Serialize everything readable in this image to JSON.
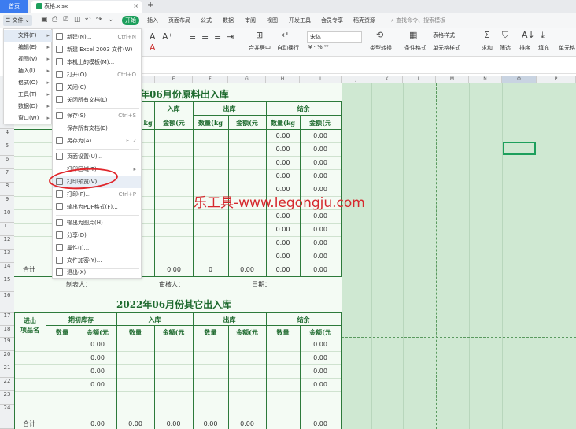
{
  "titlebar": {
    "home": "首页",
    "doc": "表格.xlsx"
  },
  "menubar": {
    "file": "文件",
    "start": "开始",
    "tabs": [
      "插入",
      "页面布局",
      "公式",
      "数据",
      "审阅",
      "视图",
      "开发工具",
      "会员专享",
      "稻壳资源"
    ],
    "search": "查找命令、搜索模板"
  },
  "ribbon": {
    "font": "宋体",
    "items": [
      "合并居中",
      "自动换行",
      "类型转换",
      "条件格式",
      "表格样式",
      "单元格样式",
      "求和",
      "筛选",
      "排序",
      "填充",
      "单元格"
    ]
  },
  "file_menu": [
    {
      "label": "文件(F)",
      "arrow": "▸"
    },
    {
      "label": "编辑(E)",
      "arrow": "▸"
    },
    {
      "label": "视图(V)",
      "arrow": "▸"
    },
    {
      "label": "插入(I)",
      "arrow": "▸"
    },
    {
      "label": "格式(O)",
      "arrow": "▸"
    },
    {
      "label": "工具(T)",
      "arrow": "▸"
    },
    {
      "label": "数据(D)",
      "arrow": "▸"
    },
    {
      "label": "窗口(W)",
      "arrow": "▸"
    }
  ],
  "submenu": [
    {
      "label": "新建(N)...",
      "shortcut": "Ctrl+N"
    },
    {
      "label": "新建 Excel 2003 文件(W)",
      "shortcut": ""
    },
    {
      "label": "本机上的模板(M)...",
      "shortcut": ""
    },
    {
      "label": "打开(O)...",
      "shortcut": "Ctrl+O"
    },
    {
      "label": "关闭(C)",
      "shortcut": ""
    },
    {
      "label": "关闭所有文档(L)",
      "shortcut": ""
    },
    {
      "label": "保存(S)",
      "shortcut": "Ctrl+S"
    },
    {
      "label": "保存所有文档(E)",
      "shortcut": ""
    },
    {
      "label": "另存为(A)...",
      "shortcut": "F12"
    },
    {
      "label": "页面设置(U)...",
      "shortcut": ""
    },
    {
      "label": "打印区域(T)",
      "shortcut": "▸"
    },
    {
      "label": "打印预览(V)",
      "shortcut": ""
    },
    {
      "label": "打印(P)...",
      "shortcut": "Ctrl+P"
    },
    {
      "label": "输出为PDF格式(F)...",
      "shortcut": ""
    },
    {
      "label": "输出为图片(H)...",
      "shortcut": ""
    },
    {
      "label": "分享(D)",
      "shortcut": ""
    },
    {
      "label": "属性(I)...",
      "shortcut": ""
    },
    {
      "label": "文件加密(Y)...",
      "shortcut": ""
    },
    {
      "label": "退出(X)",
      "shortcut": ""
    }
  ],
  "columns": [
    "E",
    "F",
    "G",
    "H",
    "I",
    "J",
    "K",
    "L",
    "M",
    "N",
    "O",
    "P"
  ],
  "rows": [
    "3",
    "4",
    "5",
    "6",
    "7",
    "8",
    "9",
    "10",
    "11",
    "12",
    "13",
    "14",
    "15",
    "16",
    "17",
    "18",
    "19",
    "20",
    "21",
    "22",
    "23",
    "24"
  ],
  "sheet1": {
    "title": "年06月份原料出入库",
    "header_in": "入库",
    "header_out": "出库",
    "header_bal": "结余",
    "sub": [
      "金额(元",
      "数量(kg",
      "金额(元",
      "数量(kg",
      "金额(元"
    ],
    "kg_hint": "kg",
    "bal_values": [
      "0.00",
      "0.00"
    ],
    "total_label": "合计",
    "total_values": [
      "0.00",
      "0",
      "0.00"
    ],
    "signers": [
      "制表人：",
      "审核人：",
      "日期："
    ]
  },
  "sheet2": {
    "title": "2022年06月份其它出入库",
    "col1": "进出",
    "col1b": "项品名",
    "groups": [
      "期初库存",
      "入库",
      "出库",
      "结余"
    ],
    "sub": [
      "数量",
      "金额(元",
      "数量",
      "金额(元",
      "数量",
      "金额(元",
      "数量",
      "金额(元"
    ],
    "zero": "0.00",
    "total_label": "合计"
  },
  "watermark": "乐工具-www.legongju.com"
}
